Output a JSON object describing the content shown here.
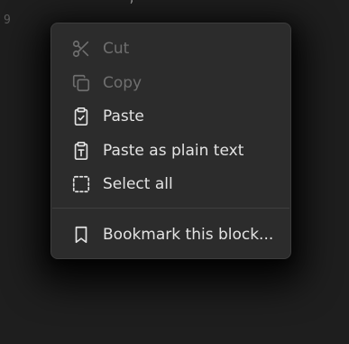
{
  "editor": {
    "line_number": "9"
  },
  "context_menu": {
    "items": [
      {
        "label": "Cut",
        "icon": "scissors-icon",
        "enabled": false
      },
      {
        "label": "Copy",
        "icon": "copy-icon",
        "enabled": false
      },
      {
        "label": "Paste",
        "icon": "clipboard-check-icon",
        "enabled": true
      },
      {
        "label": "Paste as plain text",
        "icon": "clipboard-text-icon",
        "enabled": true
      },
      {
        "label": "Select all",
        "icon": "dashed-square-icon",
        "enabled": true
      },
      {
        "label": "Bookmark this block...",
        "icon": "bookmark-icon",
        "enabled": true
      }
    ]
  },
  "colors": {
    "background": "#1e1e1e",
    "menu_background": "#2c2c2c",
    "text_enabled": "#e3e3e3",
    "text_disabled": "#6f6f6f"
  }
}
